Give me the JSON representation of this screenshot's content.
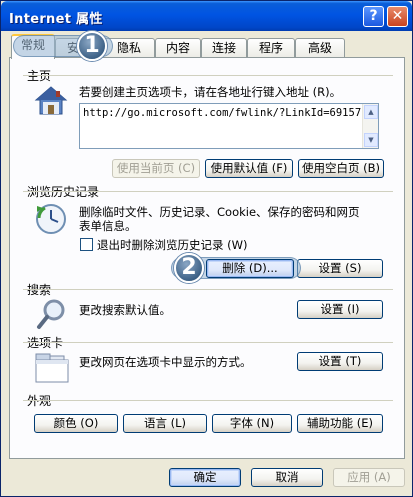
{
  "window": {
    "title": "Internet 属性",
    "help_label": "?",
    "close_label": "✕"
  },
  "tabs": [
    {
      "label": "常规",
      "active": true
    },
    {
      "label": "安全",
      "active": false
    },
    {
      "label": "隐私",
      "active": false
    },
    {
      "label": "内容",
      "active": false
    },
    {
      "label": "连接",
      "active": false
    },
    {
      "label": "程序",
      "active": false
    },
    {
      "label": "高级",
      "active": false
    }
  ],
  "callouts": {
    "first": "1",
    "second": "2"
  },
  "home_page": {
    "group_label": "主页",
    "description": "若要创建主页选项卡，请在各地址行键入地址 (R)。",
    "url": "http://go.microsoft.com/fwlink/?LinkId=69157",
    "use_current_label": "使用当前页 (C)",
    "use_default_label": "使用默认值 (F)",
    "use_blank_label": "使用空白页 (B)"
  },
  "history": {
    "group_label": "浏览历史记录",
    "description_line1": "删除临时文件、历史记录、Cookie、保存的密码和网页",
    "description_line2": "表单信息。",
    "exit_delete_label": "退出时删除浏览历史记录 (W)",
    "exit_delete_checked": false,
    "delete_label": "删除 (D)...",
    "settings_label": "设置 (S)"
  },
  "search": {
    "group_label": "搜索",
    "description": "更改搜索默认值。",
    "settings_label": "设置 (I)"
  },
  "tabs_section": {
    "group_label": "选项卡",
    "description": "更改网页在选项卡中显示的方式。",
    "settings_label": "设置 (T)"
  },
  "appearance": {
    "group_label": "外观",
    "colors_label": "颜色 (O)",
    "languages_label": "语言 (L)",
    "fonts_label": "字体 (N)",
    "accessibility_label": "辅助功能 (E)"
  },
  "footer": {
    "ok_label": "确定",
    "cancel_label": "取消",
    "apply_label": "应用 (A)"
  },
  "colors": {
    "title_bar": "#0054e3",
    "dialog_bg": "#ece9d8",
    "panel_bg": "#fcfcfe",
    "tab_highlight": "#ffc83c"
  }
}
